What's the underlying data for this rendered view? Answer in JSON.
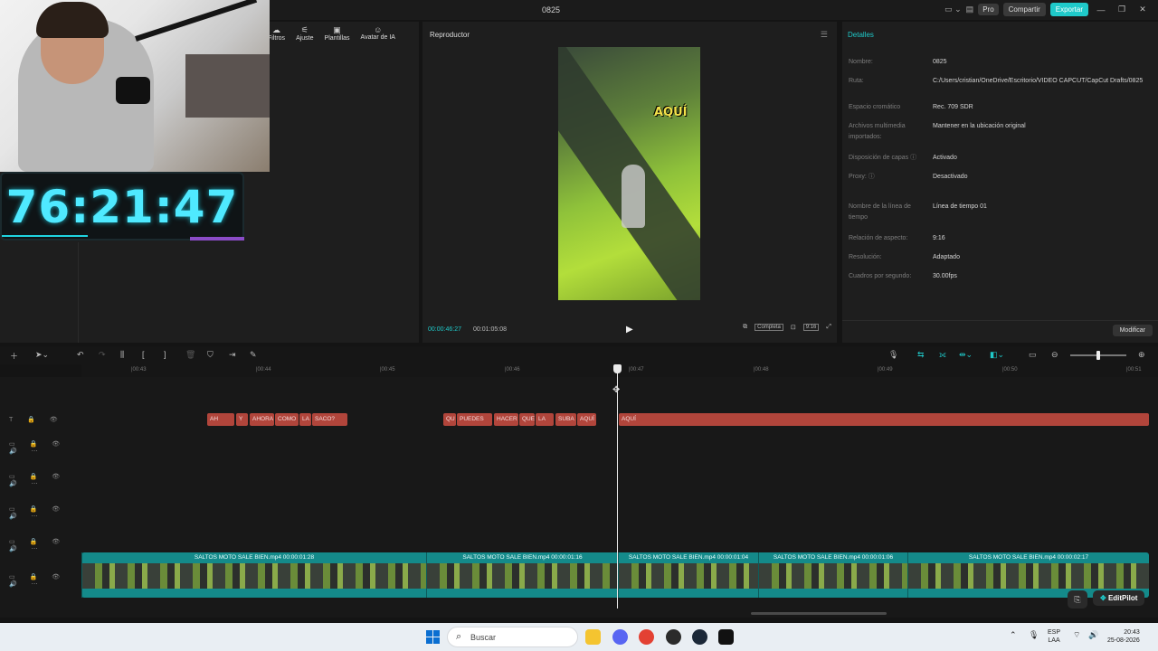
{
  "window": {
    "title": "0825"
  },
  "header": {
    "pro": "Pro",
    "share": "Compartir",
    "export": "Exportar"
  },
  "tools": [
    {
      "label": "Filtros",
      "icon": "filter-icon"
    },
    {
      "label": "Ajuste",
      "icon": "adjust-icon"
    },
    {
      "label": "Plantillas",
      "icon": "templates-icon"
    },
    {
      "label": "Avatar de IA",
      "icon": "ai-avatar-icon"
    }
  ],
  "overlay": {
    "timer": "76:21:47"
  },
  "player": {
    "title": "Reproductor",
    "caption": "AQUÍ",
    "current_time": "00:00:46:27",
    "total_time": "00:01:05:08",
    "fit_label": "Completa",
    "ratio_label": "9:16"
  },
  "details": {
    "title": "Detalles",
    "rows": [
      {
        "label": "Nombre:",
        "value": "0825"
      },
      {
        "label": "Ruta:",
        "value": "C:/Users/cristian/OneDrive/Escritorio/VIDEO CAPCUT/CapCut Drafts/0825"
      },
      {
        "label": "Espacio cromático",
        "value": "Rec. 709 SDR"
      },
      {
        "label": "Archivos multimedia importados:",
        "value": "Mantener en la ubicación original"
      },
      {
        "label": "Disposición de capas ⓘ",
        "value": "Activado"
      },
      {
        "label": "Proxy: ⓘ",
        "value": "Desactivado"
      },
      {
        "label": "Nombre de la línea de tiempo",
        "value": "Línea de tiempo 01"
      },
      {
        "label": "Relación de aspecto:",
        "value": "9:16"
      },
      {
        "label": "Resolución:",
        "value": "Adaptado"
      },
      {
        "label": "Cuadros por segundo:",
        "value": "30.00fps"
      }
    ],
    "modify_button": "Modificar"
  },
  "ruler": [
    "|00:43",
    "|00:44",
    "|00:45",
    "|00:46",
    "|00:47",
    "|00:48",
    "|00:49",
    "|00:50",
    "|00:51"
  ],
  "subtitles": [
    "AH",
    "Y",
    "AHORA",
    "COMO",
    "LA",
    "SACO?",
    "QU",
    "PUEDES",
    "HACER",
    "QUE",
    "LA",
    "SUBA",
    "AQUÍ",
    "AQUÍ"
  ],
  "video_clips": [
    "SALTOS MOTO SALE BIEN.mp4   00:00:01:28",
    "SALTOS MOTO SALE BIEN.mp4   00:00:01:16",
    "SALTOS MOTO SALE BIEN.mp4   00:00:01:04",
    "SALTOS MOTO SALE BIEN.mp4   00:00:01:06",
    "SALTOS MOTO SALE BIEN.mp4   00:00:02:17"
  ],
  "editpilot": "EditPilot",
  "taskbar": {
    "search_placeholder": "Buscar",
    "lang": "ESP",
    "layout": "LAA",
    "time": "20:43",
    "date": "25-08-2026"
  }
}
